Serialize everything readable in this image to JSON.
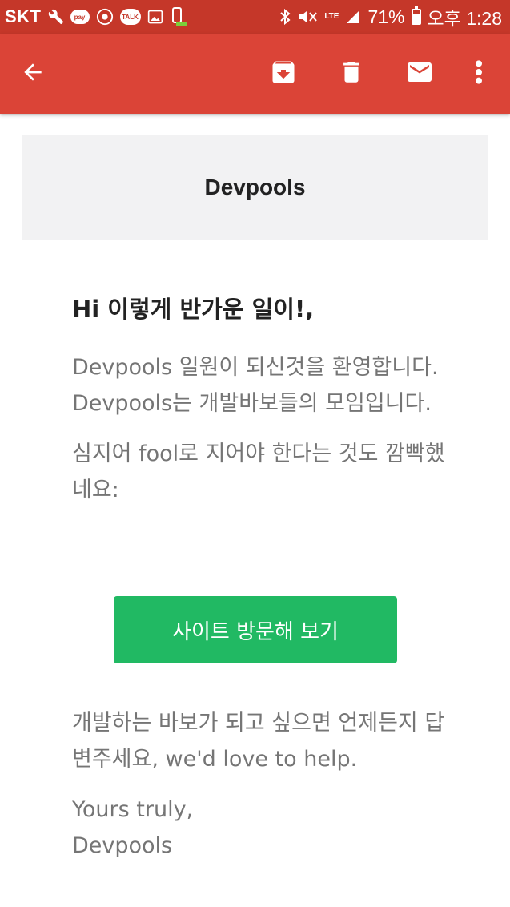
{
  "status_bar": {
    "carrier": "SKT",
    "pay_label": "pay",
    "talk_label": "TALK",
    "lte_label": "LTE",
    "battery_pct": "71%",
    "time": "오후 1:28"
  },
  "app_bar": {
    "icons": [
      "back-arrow-icon",
      "archive-icon",
      "delete-icon",
      "mail-icon",
      "more-vert-icon"
    ]
  },
  "email": {
    "header_title": "Devpools",
    "greeting": "Hi 이렇게 반가운 일이!,",
    "para1": "Devpools 일원이 되신것을 환영합니다. Devpools는 개발바보들의 모임입니다.",
    "para2": "심지어 fool로 지어야 한다는 것도 깜빡했네요:",
    "cta_label": "사이트 방문해 보기",
    "para3": "개발하는 바보가 되고 싶으면 언제든지 답변주세요, we'd love to help.",
    "sign_line1": "Yours truly,",
    "sign_line2": "Devpools"
  },
  "colors": {
    "status_bar": "#c53729",
    "app_bar": "#db4437",
    "cta": "#21b963",
    "banner": "#f2f2f3",
    "body_text": "#757575"
  }
}
